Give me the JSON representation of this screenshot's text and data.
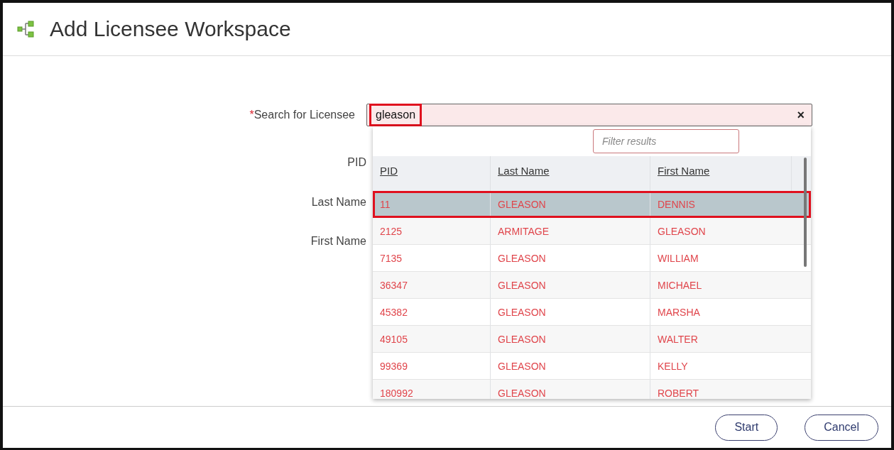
{
  "header": {
    "title": "Add Licensee Workspace"
  },
  "search": {
    "label": "Search for Licensee",
    "required_mark": "*",
    "value": "gleason",
    "highlighted": true,
    "clear": "×"
  },
  "form_labels": [
    "PID",
    "Last Name",
    "First Name"
  ],
  "dropdown": {
    "filter": {
      "placeholder": "Filter results"
    },
    "columns": [
      "PID",
      "Last Name",
      "First Name"
    ],
    "rows": [
      {
        "cells": [
          "11",
          "GLEASON",
          "DENNIS"
        ],
        "selected": true,
        "highlighted": true
      },
      {
        "cells": [
          "2125",
          "ARMITAGE",
          "GLEASON"
        ],
        "selected": false,
        "highlighted": false
      },
      {
        "cells": [
          "7135",
          "GLEASON",
          "WILLIAM"
        ],
        "selected": false,
        "highlighted": false
      },
      {
        "cells": [
          "36347",
          "GLEASON",
          "MICHAEL"
        ],
        "selected": false,
        "highlighted": false
      },
      {
        "cells": [
          "45382",
          "GLEASON",
          "MARSHA"
        ],
        "selected": false,
        "highlighted": false
      },
      {
        "cells": [
          "49105",
          "GLEASON",
          "WALTER"
        ],
        "selected": false,
        "highlighted": false
      },
      {
        "cells": [
          "99369",
          "GLEASON",
          "KELLY"
        ],
        "selected": false,
        "highlighted": false
      },
      {
        "cells": [
          "180992",
          "GLEASON",
          "ROBERT"
        ],
        "selected": false,
        "highlighted": false
      }
    ]
  },
  "buttons": [
    "Start",
    "Cancel"
  ]
}
